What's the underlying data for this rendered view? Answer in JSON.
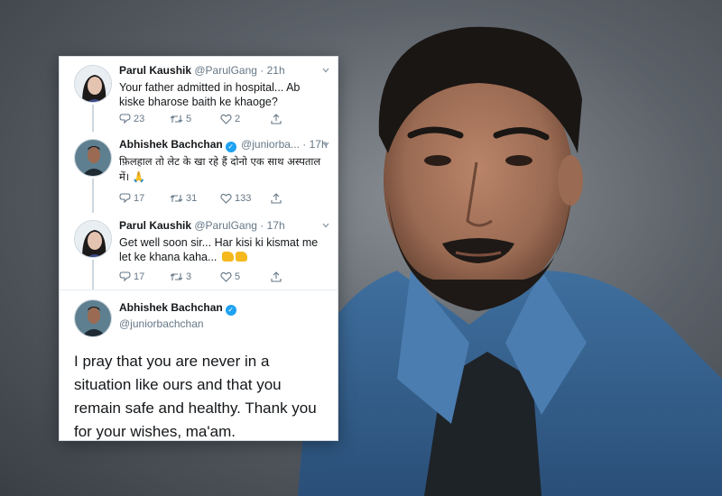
{
  "colors": {
    "accent": "#1da1f2",
    "text_primary": "#14171a",
    "text_secondary": "#657786"
  },
  "tweets": [
    {
      "name": "Parul Kaushik",
      "handle": "@ParulGang",
      "separator": "·",
      "time": "21h",
      "text": "Your father admitted in hospital... Ab kiske bharose baith ke khaoge?",
      "replies": "23",
      "retweets": "5",
      "likes": "2"
    },
    {
      "name": "Abhishek Bachchan",
      "verified": true,
      "handle": "@juniorba...",
      "separator": "·",
      "time": "17h",
      "text": "फ़िलहाल तो लेट के खा रहे हैं दोनो एक साथ अस्पताल में। 🙏",
      "replies": "17",
      "retweets": "31",
      "likes": "133"
    },
    {
      "name": "Parul Kaushik",
      "handle": "@ParulGang",
      "separator": "·",
      "time": "17h",
      "text": "Get well soon sir... Har kisi ki kismat me let ke khana kaha...",
      "replies": "17",
      "retweets": "3",
      "likes": "5"
    }
  ],
  "main_tweet": {
    "name": "Abhishek Bachchan",
    "verified": true,
    "handle": "@juniorbachchan",
    "text": "I pray that you are never in a situation like ours and that you remain safe and healthy. Thank you for your wishes, ma'am."
  },
  "icons": {
    "reply": "reply-icon",
    "retweet": "retweet-icon",
    "like": "heart-icon",
    "share": "share-icon",
    "menu": "chevron-down-icon",
    "verified": "verified-badge-icon"
  }
}
